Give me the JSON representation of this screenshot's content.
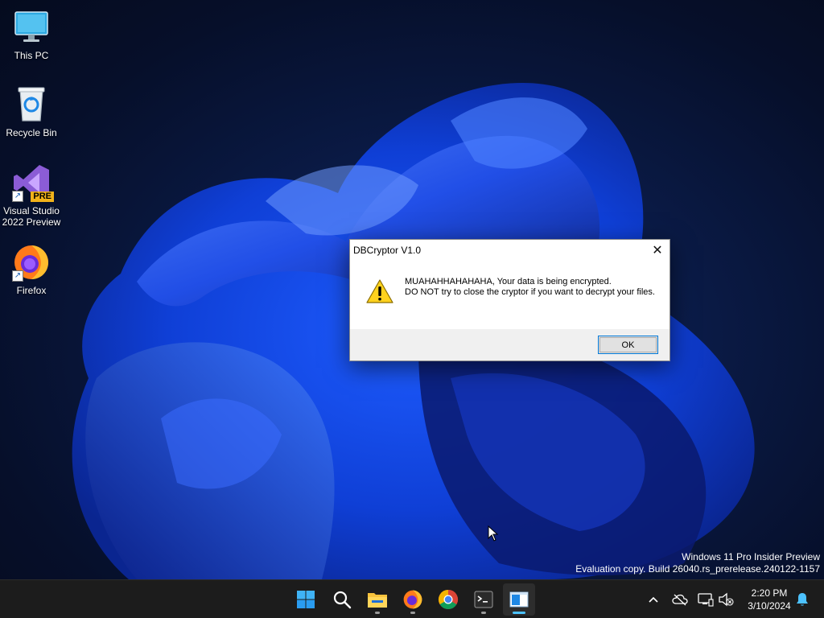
{
  "desktop": {
    "icons": [
      {
        "label": "This PC",
        "icon": "monitor-icon"
      },
      {
        "label": "Recycle Bin",
        "icon": "recycle-bin-icon"
      },
      {
        "label": "Visual Studio\n2022 Preview",
        "icon": "visual-studio-icon",
        "badge": "PRE"
      },
      {
        "label": "Firefox",
        "icon": "firefox-icon"
      }
    ],
    "watermark": {
      "line1": "Windows 11 Pro Insider Preview",
      "line2": "Evaluation copy. Build 26040.rs_prerelease.240122-1157"
    }
  },
  "dialog": {
    "title": "DBCryptor V1.0",
    "close_label": "✕",
    "message_line1": "MUAHAHHAHAHAHA, Your data is being encrypted.",
    "message_line2": "DO NOT try to close the cryptor if you want to decrypt your files.",
    "ok_label": "OK",
    "icon": "warning-icon"
  },
  "taskbar": {
    "apps": [
      {
        "name": "start-button",
        "icon": "windows-logo-icon"
      },
      {
        "name": "search-button",
        "icon": "search-icon"
      },
      {
        "name": "file-explorer-button",
        "icon": "folder-icon"
      },
      {
        "name": "firefox-taskbar-button",
        "icon": "firefox-icon"
      },
      {
        "name": "chrome-taskbar-button",
        "icon": "chrome-icon"
      },
      {
        "name": "terminal-taskbar-button",
        "icon": "terminal-icon"
      },
      {
        "name": "dbcryptor-taskbar-button",
        "icon": "app-window-icon"
      }
    ],
    "tray": {
      "time": "2:20 PM",
      "date": "3/10/2024"
    }
  },
  "colors": {
    "accent": "#0078d7",
    "taskbar_bg": "#1c1c1c",
    "active_indicator": "#4cc2ff"
  }
}
